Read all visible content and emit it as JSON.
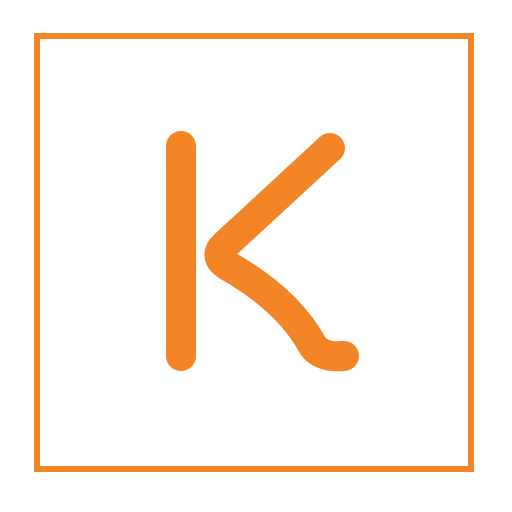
{
  "logo": {
    "letter": "K",
    "accent_color": "#F48526",
    "background_color": "#FFFFFF",
    "icon": "k-letter-logo-icon"
  }
}
